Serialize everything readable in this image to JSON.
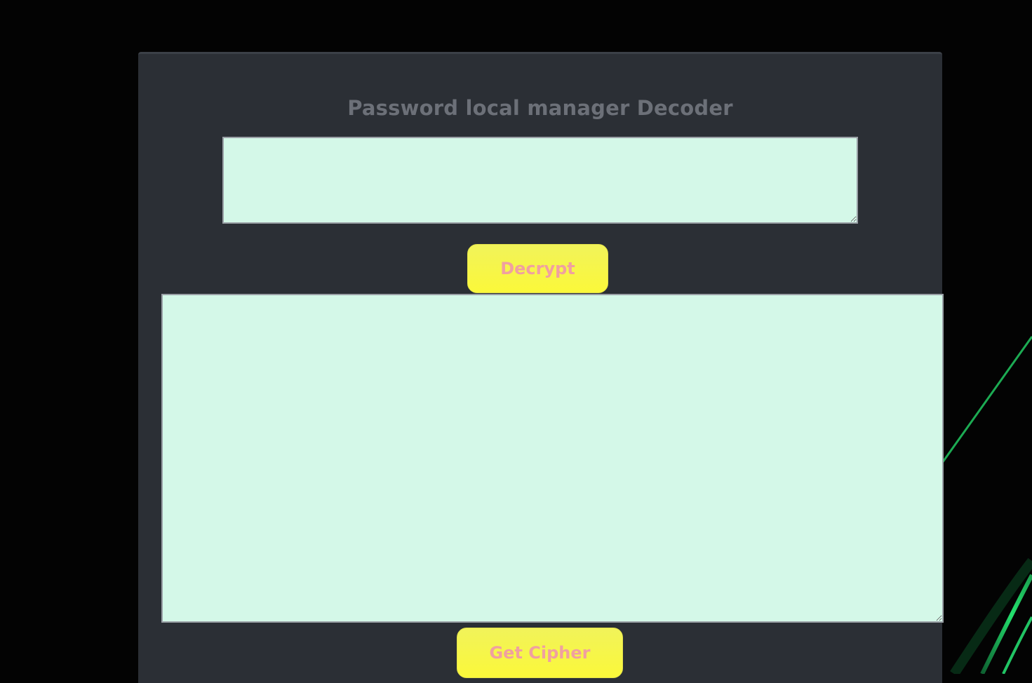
{
  "page": {
    "title": "Password local manager Decoder"
  },
  "input": {
    "value": "",
    "placeholder": ""
  },
  "decrypt_button": {
    "label": "Decrypt"
  },
  "output": {
    "value": "",
    "placeholder": ""
  },
  "cipher_button": {
    "label": "Get Cipher"
  },
  "colors": {
    "page_background": "#030303",
    "panel_background": "#2b2f35",
    "title_text": "#6c7078",
    "textarea_background": "#d4f8e8",
    "button_background": "#f7f64a",
    "button_text": "#f0a0a0",
    "accent_glow": "#22e070"
  }
}
